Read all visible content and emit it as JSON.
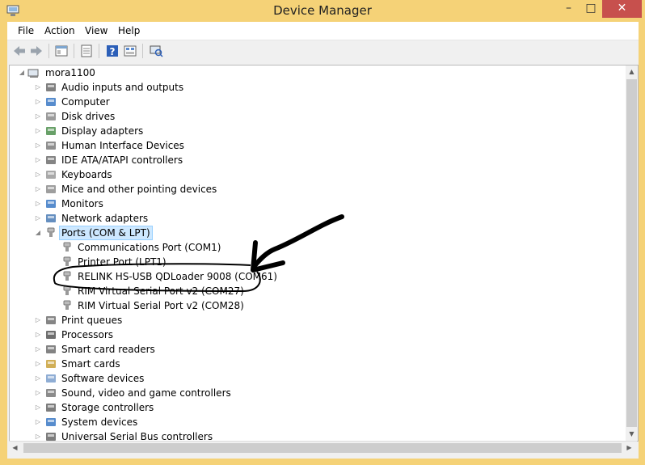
{
  "window": {
    "title": "Device Manager"
  },
  "menu": [
    "File",
    "Action",
    "View",
    "Help"
  ],
  "toolbar": {
    "buttons": [
      "back-icon",
      "forward-icon",
      "properties-icon",
      "show-hidden-icon",
      "help-icon",
      "view-icon",
      "scan-hardware-icon"
    ]
  },
  "tree": {
    "root": "mora1100",
    "categories": [
      {
        "label": "Audio inputs and outputs",
        "icon": "speaker-icon",
        "expanded": false
      },
      {
        "label": "Computer",
        "icon": "computer-icon",
        "expanded": false
      },
      {
        "label": "Disk drives",
        "icon": "disk-drive-icon",
        "expanded": false
      },
      {
        "label": "Display adapters",
        "icon": "display-adapter-icon",
        "expanded": false
      },
      {
        "label": "Human Interface Devices",
        "icon": "hid-icon",
        "expanded": false
      },
      {
        "label": "IDE ATA/ATAPI controllers",
        "icon": "ide-controller-icon",
        "expanded": false
      },
      {
        "label": "Keyboards",
        "icon": "keyboard-icon",
        "expanded": false
      },
      {
        "label": "Mice and other pointing devices",
        "icon": "mouse-icon",
        "expanded": false
      },
      {
        "label": "Monitors",
        "icon": "monitor-icon",
        "expanded": false
      },
      {
        "label": "Network adapters",
        "icon": "network-adapter-icon",
        "expanded": false
      },
      {
        "label": "Ports (COM & LPT)",
        "icon": "port-icon",
        "expanded": true,
        "selected": true,
        "children": [
          "Communications Port (COM1)",
          "Printer Port (LPT1)",
          "RELINK HS-USB QDLoader 9008 (COM61)",
          "RIM Virtual Serial Port v2 (COM27)",
          "RIM Virtual Serial Port v2 (COM28)"
        ]
      },
      {
        "label": "Print queues",
        "icon": "printer-icon",
        "expanded": false
      },
      {
        "label": "Processors",
        "icon": "processor-icon",
        "expanded": false
      },
      {
        "label": "Smart card readers",
        "icon": "smart-card-reader-icon",
        "expanded": false
      },
      {
        "label": "Smart cards",
        "icon": "smart-card-icon",
        "expanded": false
      },
      {
        "label": "Software devices",
        "icon": "software-device-icon",
        "expanded": false
      },
      {
        "label": "Sound, video and game controllers",
        "icon": "sound-icon",
        "expanded": false
      },
      {
        "label": "Storage controllers",
        "icon": "storage-controller-icon",
        "expanded": false
      },
      {
        "label": "System devices",
        "icon": "system-device-icon",
        "expanded": false
      },
      {
        "label": "Universal Serial Bus controllers",
        "icon": "usb-icon",
        "expanded": false
      }
    ]
  },
  "colors": {
    "frame": "#f5d277",
    "selection": "#cde8ff",
    "close": "#c7504d"
  }
}
